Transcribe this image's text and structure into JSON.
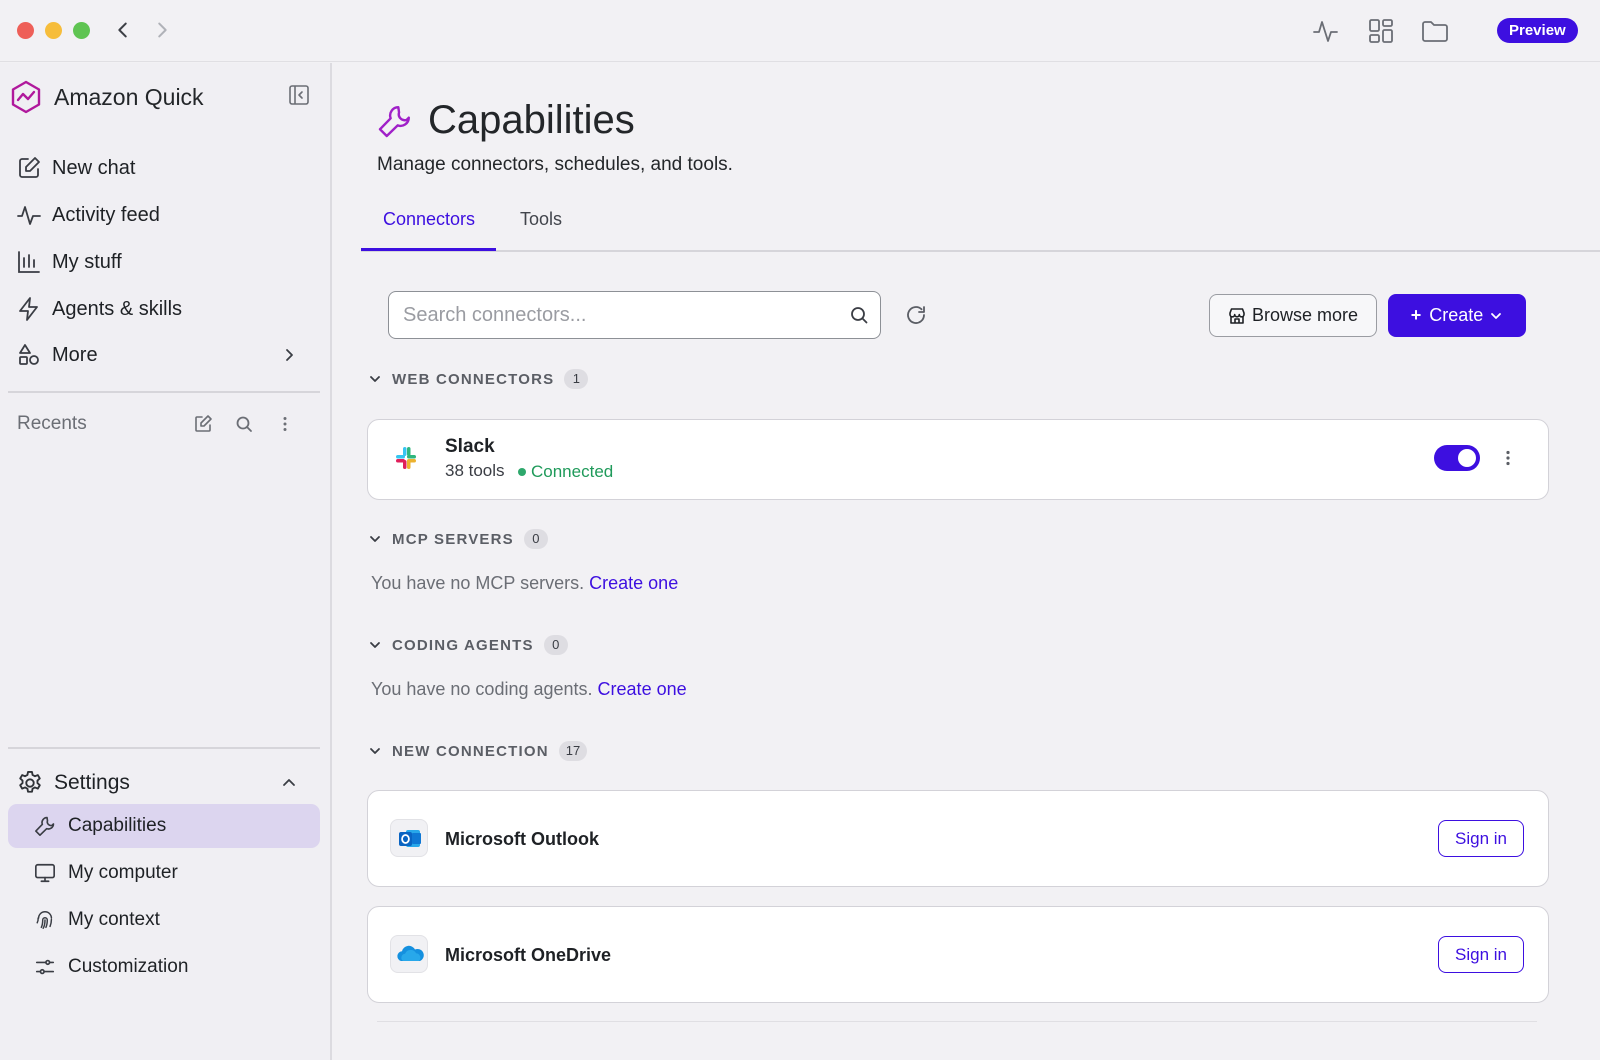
{
  "window": {
    "preview_label": "Preview",
    "icons": [
      "chevron-left-icon",
      "chevron-right-icon",
      "activity-icon",
      "grid-icon",
      "folder-icon"
    ]
  },
  "sidebar": {
    "brand": "Amazon Quick",
    "nav": [
      {
        "label": "New chat",
        "icon": "edit-icon"
      },
      {
        "label": "Activity feed",
        "icon": "activity-icon"
      },
      {
        "label": "My stuff",
        "icon": "bar-chart-icon"
      },
      {
        "label": "Agents & skills",
        "icon": "lightning-icon"
      },
      {
        "label": "More",
        "icon": "shapes-icon"
      }
    ],
    "recents_label": "Recents",
    "settings_label": "Settings",
    "settings_items": [
      {
        "label": "Capabilities",
        "icon": "wrench-icon",
        "active": true
      },
      {
        "label": "My computer",
        "icon": "monitor-icon",
        "active": false
      },
      {
        "label": "My context",
        "icon": "fingerprint-icon",
        "active": false
      },
      {
        "label": "Customization",
        "icon": "sliders-icon",
        "active": false
      }
    ]
  },
  "page": {
    "title": "Capabilities",
    "subtitle": "Manage connectors, schedules, and tools.",
    "tabs": [
      {
        "label": "Connectors",
        "active": true
      },
      {
        "label": "Tools",
        "active": false
      }
    ]
  },
  "toolbar": {
    "search_placeholder": "Search connectors...",
    "search_value": "",
    "browse_label": "Browse more",
    "create_label": "Create"
  },
  "sections": {
    "web": {
      "title": "WEB CONNECTORS",
      "count": "1"
    },
    "mcp": {
      "title": "MCP SERVERS",
      "count": "0",
      "empty_text": "You have no MCP servers.",
      "link": "Create one"
    },
    "coding": {
      "title": "CODING AGENTS",
      "count": "0",
      "empty_text": "You have no coding agents.",
      "link": "Create one"
    },
    "new": {
      "title": "NEW CONNECTION",
      "count": "17"
    }
  },
  "slack": {
    "name": "Slack",
    "tools": "38 tools",
    "status": "Connected",
    "enabled": true
  },
  "new_connections": [
    {
      "name": "Microsoft Outlook",
      "action": "Sign in"
    },
    {
      "name": "Microsoft OneDrive",
      "action": "Sign in"
    }
  ],
  "colors": {
    "accent": "#3d0fe0",
    "active_nav_bg": "#dcd5ef",
    "connected": "#1f9a5a",
    "brand_icon": "#a020c8"
  }
}
